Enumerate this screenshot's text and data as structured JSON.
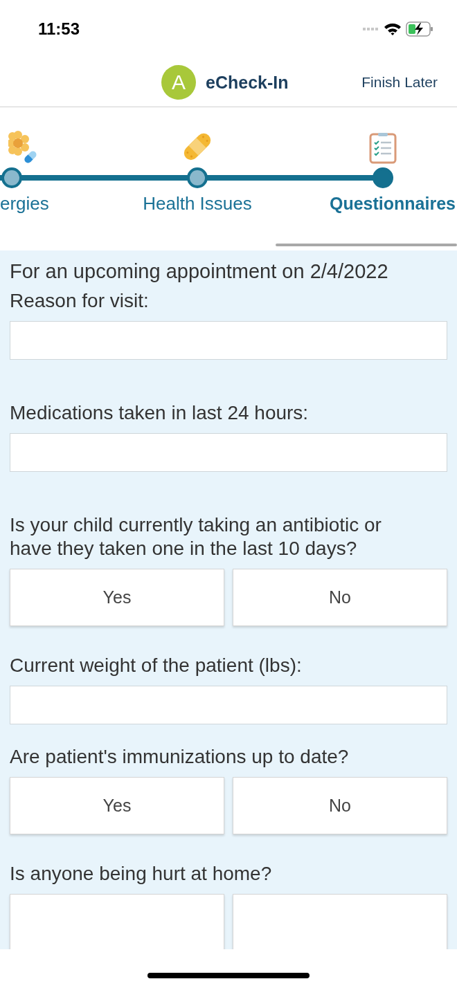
{
  "status_bar": {
    "time": "11:53"
  },
  "header": {
    "avatar_letter": "A",
    "title": "eCheck-In",
    "finish_later": "Finish Later"
  },
  "steps": [
    {
      "label": "ergies",
      "selected": false,
      "kind": "allergy"
    },
    {
      "label": "Health Issues",
      "selected": false,
      "kind": "bandage"
    },
    {
      "label": "Questionnaires",
      "selected": true,
      "kind": "clipboard"
    }
  ],
  "intro": "For an upcoming appointment on 2/4/2022",
  "questions": [
    {
      "kind": "text",
      "label": "Reason for visit:"
    },
    {
      "kind": "text",
      "label": "Medications taken in last 24 hours:"
    },
    {
      "kind": "yesno",
      "label": "Is your child currently taking an antibiotic or have they taken one in the last 10 days?",
      "options": [
        "Yes",
        "No"
      ]
    },
    {
      "kind": "text",
      "label": "Current weight of the patient (lbs):"
    },
    {
      "kind": "yesno",
      "label": "Are patient's immunizations up to date?",
      "options": [
        "Yes",
        "No"
      ]
    },
    {
      "kind": "cut",
      "label": "Is anyone being hurt at home?"
    }
  ]
}
